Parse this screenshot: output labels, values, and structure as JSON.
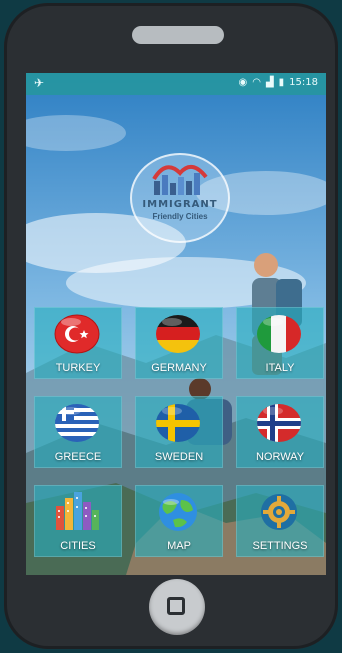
{
  "status_bar": {
    "time": "15:18",
    "left_icon": "app-notification-icon"
  },
  "logo": {
    "title": "IMMIGRANT",
    "subtitle": "Friendly Cities"
  },
  "tiles": [
    {
      "label": "TURKEY",
      "icon": "turkey-flag-icon"
    },
    {
      "label": "GERMANY",
      "icon": "germany-flag-icon"
    },
    {
      "label": "ITALY",
      "icon": "italy-flag-icon"
    },
    {
      "label": "GREECE",
      "icon": "greece-flag-icon"
    },
    {
      "label": "SWEDEN",
      "icon": "sweden-flag-icon"
    },
    {
      "label": "NORWAY",
      "icon": "norway-flag-icon"
    },
    {
      "label": "CITIES",
      "icon": "city-buildings-icon"
    },
    {
      "label": "MAP",
      "icon": "globe-icon"
    },
    {
      "label": "SETTINGS",
      "icon": "gear-icon"
    }
  ],
  "colors": {
    "tile": "#28afbe",
    "statusbar": "#2696a0",
    "phone_body": "#2b2f33"
  }
}
